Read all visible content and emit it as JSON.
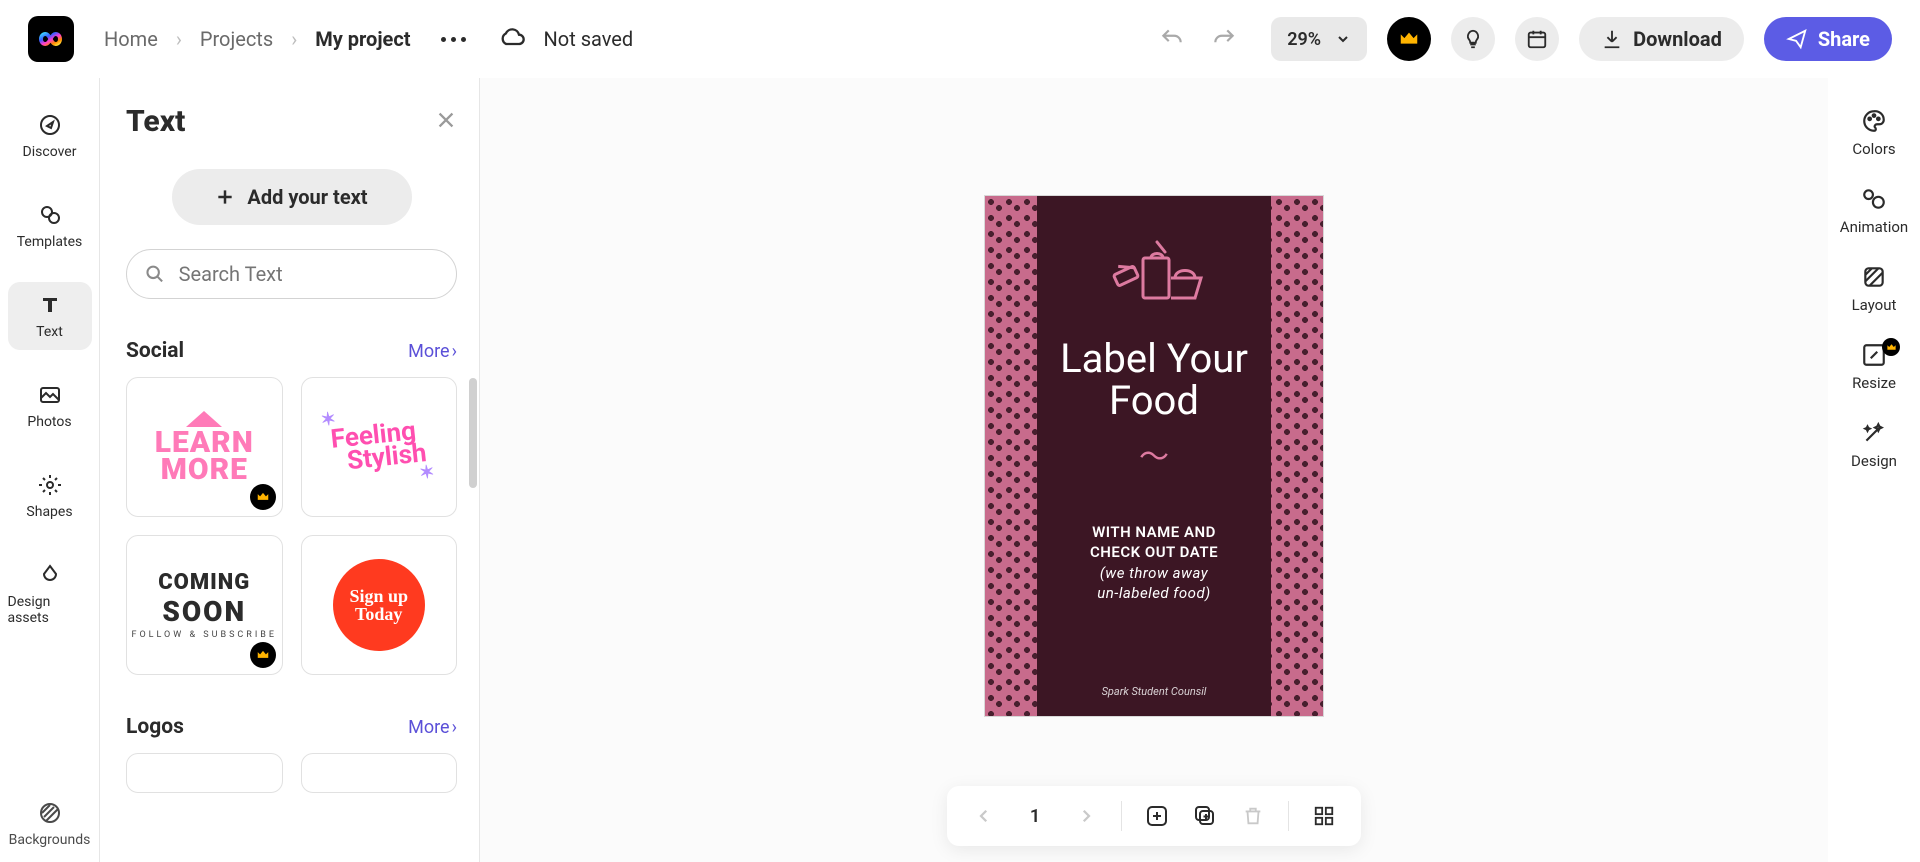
{
  "breadcrumb": {
    "home": "Home",
    "projects": "Projects",
    "current": "My project"
  },
  "saveStatus": "Not saved",
  "zoom": "29%",
  "buttons": {
    "download": "Download",
    "share": "Share",
    "addText": "Add your text"
  },
  "search": {
    "placeholder": "Search Text"
  },
  "leftRail": {
    "discover": "Discover",
    "templates": "Templates",
    "text": "Text",
    "photos": "Photos",
    "shapes": "Shapes",
    "designAssets": "Design assets",
    "backgrounds": "Backgrounds"
  },
  "panel": {
    "title": "Text"
  },
  "sections": {
    "social": {
      "title": "Social",
      "more": "More"
    },
    "logos": {
      "title": "Logos",
      "more": "More"
    }
  },
  "thumbs": {
    "learn1": "LEARN",
    "learn2": "MORE",
    "feeling1": "Feeling",
    "feeling2": "Stylish",
    "coming1": "COMING",
    "coming2": "SOON",
    "coming3": "FOLLOW & SUBSCRIBE",
    "signup": "Sign up\nToday"
  },
  "artboard": {
    "title1": "Label Your",
    "title2": "Food",
    "sub1": "WITH NAME AND",
    "sub2": "CHECK OUT DATE",
    "sub3": "(we throw away",
    "sub4": "un-labeled food)",
    "footer": "Spark Student Counsil"
  },
  "page": {
    "current": "1"
  },
  "rightRail": {
    "colors": "Colors",
    "animation": "Animation",
    "layout": "Layout",
    "resize": "Resize",
    "design": "Design"
  }
}
